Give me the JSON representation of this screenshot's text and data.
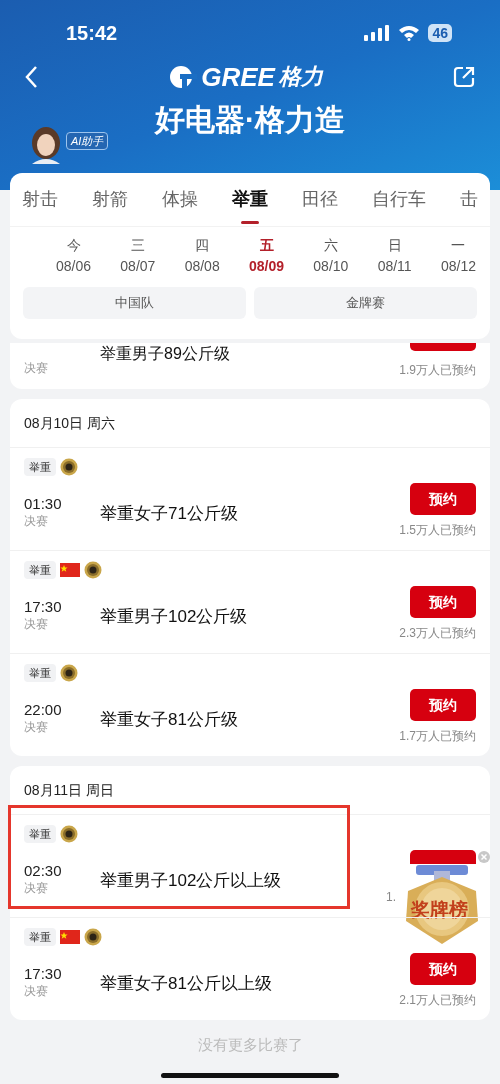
{
  "status_bar": {
    "time": "15:42",
    "battery": "46"
  },
  "header": {
    "logo_text": "GREE",
    "logo_script": "格力",
    "slogan": "好电器·格力造",
    "assistant_badge": "AI助手"
  },
  "sport_tabs": [
    {
      "label": "射击",
      "selected": false
    },
    {
      "label": "射箭",
      "selected": false
    },
    {
      "label": "体操",
      "selected": false
    },
    {
      "label": "举重",
      "selected": true
    },
    {
      "label": "田径",
      "selected": false
    },
    {
      "label": "自行车",
      "selected": false
    },
    {
      "label": "击",
      "selected": false
    }
  ],
  "dates": [
    {
      "weekday": "今",
      "date": "08/06",
      "selected": false
    },
    {
      "weekday": "三",
      "date": "08/07",
      "selected": false
    },
    {
      "weekday": "四",
      "date": "08/08",
      "selected": false
    },
    {
      "weekday": "五",
      "date": "08/09",
      "selected": true
    },
    {
      "weekday": "六",
      "date": "08/10",
      "selected": false
    },
    {
      "weekday": "日",
      "date": "08/11",
      "selected": false
    },
    {
      "weekday": "一",
      "date": "08/12",
      "selected": false
    }
  ],
  "filters": [
    {
      "label": "中国队"
    },
    {
      "label": "金牌赛"
    }
  ],
  "partial_event": {
    "stage": "决赛",
    "title": "举重男子89公斤级",
    "count": "1.9万人已预约"
  },
  "days": [
    {
      "date": "08月10日 周六",
      "events": [
        {
          "tag": "举重",
          "china_flag": false,
          "medal": true,
          "time": "01:30",
          "stage": "决赛",
          "title": "举重女子71公斤级",
          "button": "预约",
          "count": "1.5万人已预约",
          "highlighted": false
        },
        {
          "tag": "举重",
          "china_flag": true,
          "medal": true,
          "time": "17:30",
          "stage": "决赛",
          "title": "举重男子102公斤级",
          "button": "预约",
          "count": "2.3万人已预约",
          "highlighted": false
        },
        {
          "tag": "举重",
          "china_flag": false,
          "medal": true,
          "time": "22:00",
          "stage": "决赛",
          "title": "举重女子81公斤级",
          "button": "预约",
          "count": "1.7万人已预约",
          "highlighted": false
        }
      ]
    },
    {
      "date": "08月11日 周日",
      "events": [
        {
          "tag": "举重",
          "china_flag": false,
          "medal": true,
          "time": "02:30",
          "stage": "决赛",
          "title": "举重男子102公斤以上级",
          "count": "1.",
          "highlighted": true,
          "overlay": {
            "label": "奖牌榜"
          }
        },
        {
          "tag": "举重",
          "china_flag": true,
          "medal": true,
          "time": "17:30",
          "stage": "决赛",
          "title": "举重女子81公斤以上级",
          "button": "预约",
          "count": "2.1万人已预约",
          "highlighted": false
        }
      ]
    }
  ],
  "footer": "没有更多比赛了"
}
